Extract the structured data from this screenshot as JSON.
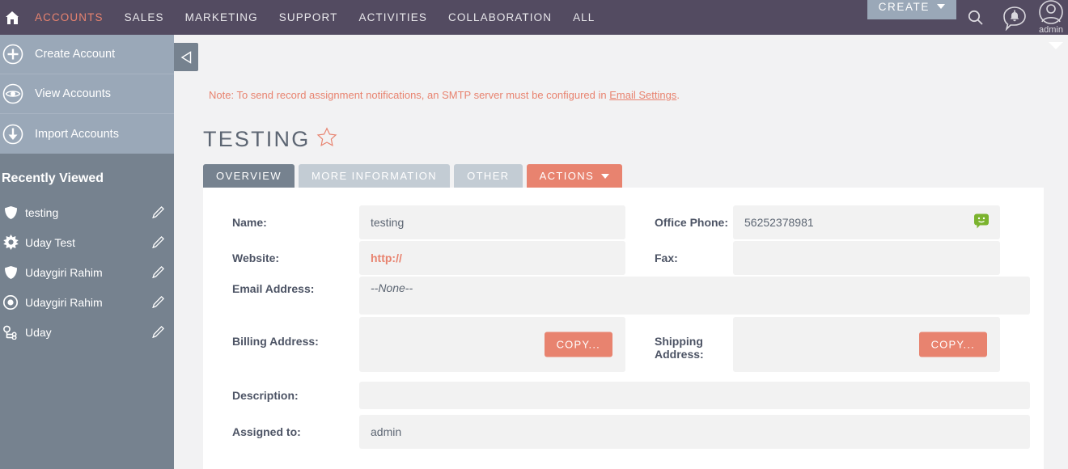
{
  "topnav": {
    "home_icon": "home-icon",
    "items": [
      {
        "label": "ACCOUNTS",
        "active": true
      },
      {
        "label": "SALES",
        "active": false
      },
      {
        "label": "MARKETING",
        "active": false
      },
      {
        "label": "SUPPORT",
        "active": false
      },
      {
        "label": "ACTIVITIES",
        "active": false
      },
      {
        "label": "COLLABORATION",
        "active": false
      },
      {
        "label": "ALL",
        "active": false
      }
    ],
    "create_label": "CREATE",
    "search_icon": "search-icon",
    "notification_icon": "notification-bell-icon",
    "avatar_icon": "avatar-icon",
    "avatar_label": "admin"
  },
  "sidebar": {
    "actions": [
      {
        "label": "Create Account",
        "icon": "plus-circle-icon"
      },
      {
        "label": "View Accounts",
        "icon": "eye-circle-icon"
      },
      {
        "label": "Import Accounts",
        "icon": "download-circle-icon"
      }
    ],
    "recently_viewed_title": "Recently Viewed",
    "recent": [
      {
        "label": "testing",
        "icon": "shield-icon",
        "edit_icon": "pencil-icon"
      },
      {
        "label": "Uday Test",
        "icon": "burst-star-icon",
        "edit_icon": "pencil-icon"
      },
      {
        "label": "Udaygiri Rahim",
        "icon": "shield-icon",
        "edit_icon": "pencil-icon"
      },
      {
        "label": "Udaygiri Rahim",
        "icon": "target-icon",
        "edit_icon": "pencil-icon"
      },
      {
        "label": "Uday",
        "icon": "contact-icon",
        "edit_icon": "pencil-icon"
      }
    ],
    "collapse_icon": "collapse-left-icon"
  },
  "page": {
    "caret_icon": "chevron-down-icon",
    "note_prefix": "Note: To send record assignment notifications, an SMTP server must be configured in ",
    "note_link": "Email Settings",
    "note_suffix": ".",
    "title": "TESTING",
    "favorite_icon": "star-outline-icon"
  },
  "tabs": [
    {
      "label": "OVERVIEW",
      "state": "active"
    },
    {
      "label": "MORE INFORMATION",
      "state": "inactive"
    },
    {
      "label": "OTHER",
      "state": "inactive"
    },
    {
      "label": "ACTIONS",
      "state": "actions"
    }
  ],
  "fields": {
    "name_label": "Name:",
    "name_value": "testing",
    "office_phone_label": "Office Phone:",
    "office_phone_value": "56252378981",
    "office_phone_sms_icon": "sms-chat-icon",
    "website_label": "Website:",
    "website_value": "http://",
    "fax_label": "Fax:",
    "fax_value": "",
    "email_label": "Email Address:",
    "email_value": "--None--",
    "billing_label": "Billing Address:",
    "billing_value": "",
    "billing_copy_label": "COPY...",
    "shipping_label": "Shipping Address:",
    "shipping_value": "",
    "shipping_copy_label": "COPY...",
    "description_label": "Description:",
    "description_value": "",
    "assigned_label": "Assigned to:",
    "assigned_value": "admin"
  },
  "colors": {
    "nav_bg": "#534b61",
    "accent": "#e8836f",
    "sidebar_top": "#9aa8b8",
    "sidebar_bottom": "#76828f",
    "tab_active": "#76828f",
    "sms_green": "#7bb32e"
  }
}
